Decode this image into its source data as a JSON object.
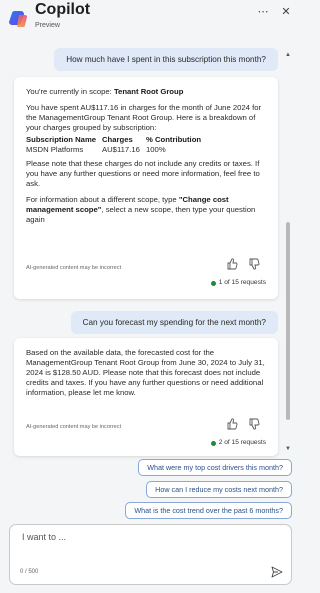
{
  "header": {
    "title": "Copilot",
    "subtitle": "Preview",
    "more_icon": "ellipsis-icon",
    "close_icon": "close-icon"
  },
  "conversation": {
    "user_1": "How much have I spent in this subscription this month?",
    "bot_1": {
      "scope_prefix": "You're currently in scope: ",
      "scope_name": "Tenant Root Group",
      "intro": "You have spent AU$117.16 in charges for the month of June 2024 for the ManagementGroup Tenant Root Group. Here is a breakdown of your charges grouped by subscription:",
      "table_headers": [
        "Subscription Name",
        "Charges",
        "% Contribution"
      ],
      "table_rows": [
        [
          "MSDN Platforms",
          "AU$117.16",
          "100%"
        ]
      ],
      "note": "Please note that these charges do not include any credits or taxes. If you have any further questions or need more information, feel free to ask.",
      "scope_tip_pre": "For information about a different scope, type ",
      "scope_tip_cmd": "\"Change cost management scope\"",
      "scope_tip_post": ", select a new scope, then type your question again",
      "disclaimer": "AI-generated content may be incorrect",
      "requests": "1 of 15 requests"
    },
    "user_2": "Can you forecast my spending for the next month?",
    "bot_2": {
      "text": "Based on the available data, the forecasted cost for the ManagementGroup Tenant Root Group from June 30, 2024 to July 31, 2024 is $128.50 AUD. Please note that this forecast does not include credits and taxes. If you have any further questions or need additional information, please let me know.",
      "disclaimer": "AI-generated content may be incorrect",
      "requests": "2 of 15 requests"
    }
  },
  "suggestions": [
    "What were my top cost drivers this month?",
    "How can I reduce my costs next month?",
    "What is the cost trend over the past 6 months?"
  ],
  "composer": {
    "placeholder": "I want to ...",
    "counter": "0 / 500"
  },
  "colors": {
    "accent": "#2c4f8c",
    "user_bubble": "#dfe9f7",
    "status_green": "#1e8a3c"
  }
}
